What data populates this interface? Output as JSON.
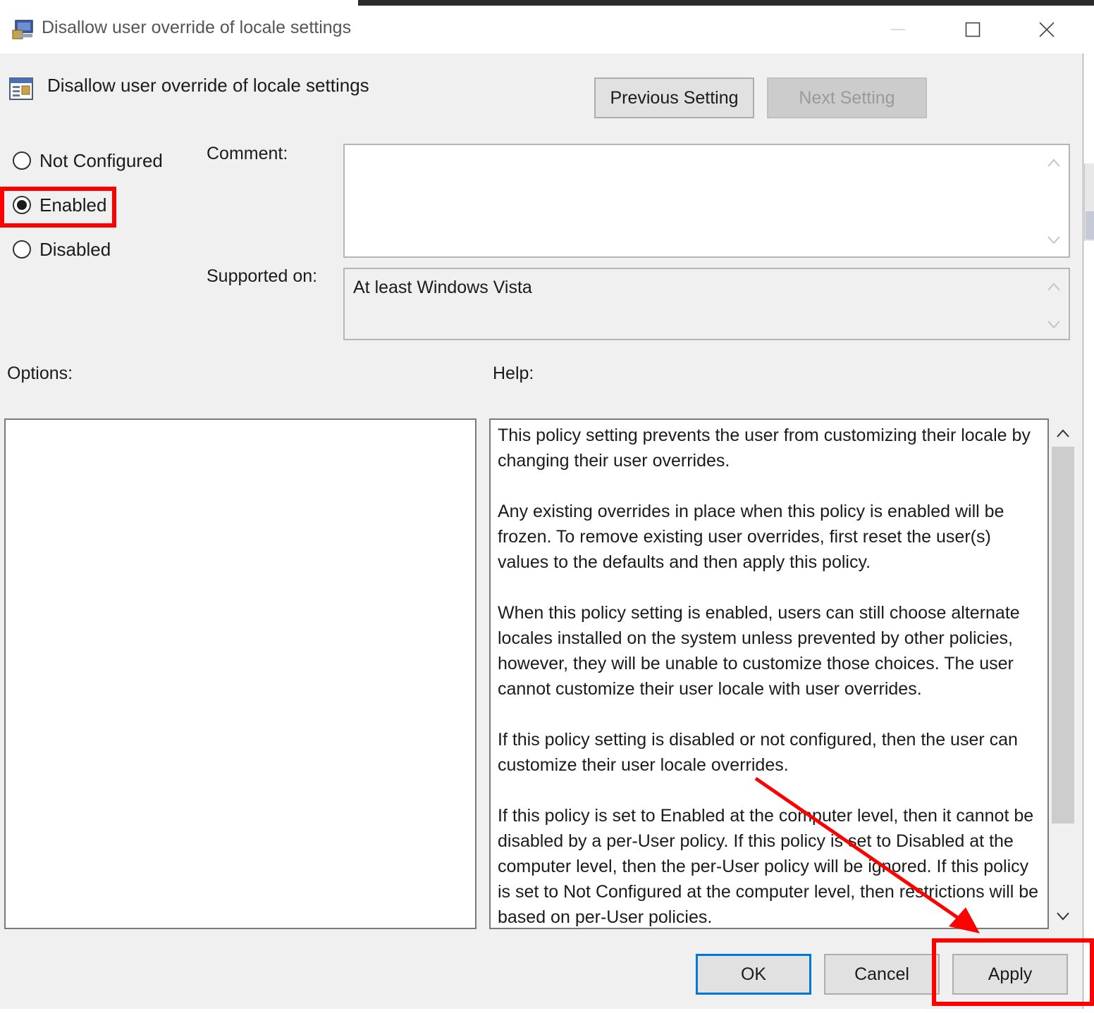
{
  "dialog": {
    "title": "Disallow user override of locale settings",
    "policy_title": "Disallow user override of locale settings"
  },
  "nav": {
    "previous_label": "Previous Setting",
    "next_label": "Next Setting"
  },
  "state": {
    "options": [
      {
        "label": "Not Configured",
        "selected": false
      },
      {
        "label": "Enabled",
        "selected": true
      },
      {
        "label": "Disabled",
        "selected": false
      }
    ]
  },
  "comment": {
    "label": "Comment:",
    "value": ""
  },
  "supported": {
    "label": "Supported on:",
    "value": "At least Windows Vista"
  },
  "sections": {
    "options_label": "Options:",
    "help_label": "Help:"
  },
  "help": {
    "paragraphs": [
      "This policy setting prevents the user from customizing their locale by changing their user overrides.",
      "Any existing overrides in place when this policy is enabled will be frozen. To remove existing user overrides, first reset the user(s) values to the defaults and then apply this policy.",
      "When this policy setting is enabled, users can still choose alternate locales installed on the system unless prevented by other policies, however, they will be unable to customize those choices.  The user cannot customize their user locale with user overrides.",
      "If this policy setting is disabled or not configured, then the user can customize their user locale overrides.",
      "If this policy is set to Enabled at the computer level, then it cannot be disabled by a per-User policy. If this policy is set to Disabled at the computer level, then the per-User policy will be ignored. If this policy is set to Not Configured at the computer level, then restrictions will be based on per-User policies."
    ]
  },
  "buttons": {
    "ok": "OK",
    "cancel": "Cancel",
    "apply": "Apply"
  },
  "annotations": {
    "highlight_color": "#ff0000"
  },
  "icons": {
    "app": "policy-editor-icon",
    "policy": "policy-setting-icon",
    "minimize": "minimize-icon",
    "maximize": "maximize-icon",
    "close": "close-icon"
  }
}
